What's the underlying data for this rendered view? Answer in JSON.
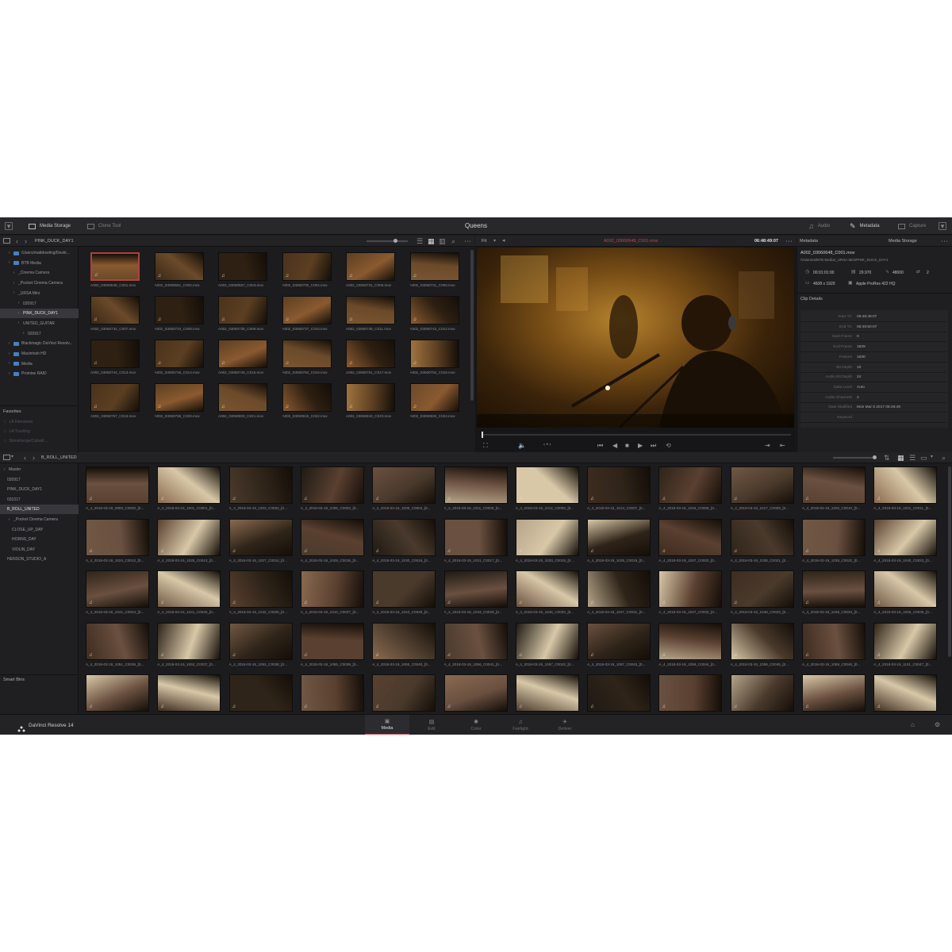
{
  "app": {
    "title": "Queens",
    "brand": "DaVinci Resolve 14"
  },
  "topbar": {
    "media_storage": "Media Storage",
    "clone_tool": "Clone Tool",
    "audio": "Audio",
    "metadata": "Metadata",
    "capture": "Capture"
  },
  "media_storage": {
    "path_label": "PINK_DUCK_DAY1",
    "tree": [
      {
        "label": "/Users/mattdowling/Deskt...",
        "indent": 1,
        "selected": false
      },
      {
        "label": "BTB Media",
        "indent": 1,
        "selected": false
      },
      {
        "label": "_Cinema Camera",
        "indent": 2,
        "selected": false
      },
      {
        "label": "_Pocket Cinema Camera",
        "indent": 2,
        "selected": false
      },
      {
        "label": "_URSA Mini",
        "indent": 2,
        "selected": false
      },
      {
        "label": "020917",
        "indent": 3,
        "selected": false
      },
      {
        "label": "PINK_DUCK_DAY1",
        "indent": 3,
        "selected": true
      },
      {
        "label": "UNITED_GUITAR",
        "indent": 3,
        "selected": false
      },
      {
        "label": "020917",
        "indent": 4,
        "selected": false
      },
      {
        "label": "Blackmagic DaVinci Resolv...",
        "indent": 1,
        "selected": false
      },
      {
        "label": "Macintosh HD",
        "indent": 1,
        "selected": false
      },
      {
        "label": "Media",
        "indent": 1,
        "selected": false
      },
      {
        "label": "Promise RAID",
        "indent": 1,
        "selected": false
      }
    ],
    "favorites_title": "Favorites",
    "favorites": [
      "LA Interviews",
      "LA Tracking",
      "Stonehenge/Cobalt/..."
    ],
    "clips": [
      "A002_03060648_C001.mov",
      "A002_03060651_C002.mov",
      "A002_03060657_C003.mov",
      "A002_03060700_C004.mov",
      "A002_03060731_C005.mov",
      "A002_03060731_C006.mov",
      "A002_03060732_C007.mov",
      "A002_03060734_C008.mov",
      "A002_03060735_C009.mov",
      "A002_03060737_C010.mov",
      "A002_03060738_C011.mov",
      "A002_03060743_C012.mov",
      "A002_03060744_C013.mov",
      "A002_03060746_C014.mov",
      "A002_03060749_C015.mov",
      "A002_03060750_C016.mov",
      "A002_03060751_C017.mov",
      "A002_03060752_C018.mov",
      "A002_03060757_C019.mov",
      "A002_03060758_C020.mov",
      "A002_03060803_C021.mov",
      "A002_03060815_C022.mov",
      "A002_03060819_C023.mov",
      "A002_03060825_C024.mov"
    ]
  },
  "viewer": {
    "zoom": "Fit",
    "clip_name": "A002_03060648_C001.mov",
    "timecode": "06:48:49:07"
  },
  "metadata_panel": {
    "title": "Metadata",
    "context": "Media Storage",
    "file_name": "A002_03060648_C001.mov",
    "file_path": "/Volumes/BTB Media/_URSA Mini/PINK_DUCK_DAY1",
    "duration": "00:01:01:00",
    "fps": "29.970",
    "sample_rate": "48000",
    "channels": "2",
    "resolution": "4608 x 1920",
    "codec": "Apple ProRes 422 HQ",
    "clip_details_title": "Clip Details",
    "details": [
      {
        "k": "Start TC",
        "v": "06:48:49:07"
      },
      {
        "k": "End TC",
        "v": "06:49:50:07"
      },
      {
        "k": "Start Frame",
        "v": "0"
      },
      {
        "k": "End Frame",
        "v": "1829"
      },
      {
        "k": "Frames",
        "v": "1830"
      },
      {
        "k": "Bit Depth",
        "v": "10"
      },
      {
        "k": "Audio Bit Depth",
        "v": "24"
      },
      {
        "k": "Data Level",
        "v": "Auto"
      },
      {
        "k": "Audio Channels",
        "v": "2"
      },
      {
        "k": "Date Modified",
        "v": "Mon Mar 6 2017 06:48:49"
      },
      {
        "k": "Keyword",
        "v": ""
      }
    ]
  },
  "media_pool": {
    "bin_label": "B_ROLL_UNITED",
    "tree": [
      {
        "label": "Master",
        "indent": 0,
        "selected": false
      },
      {
        "label": "020917",
        "indent": 1,
        "selected": false
      },
      {
        "label": "PINK_DUCK_DAY1",
        "indent": 1,
        "selected": false
      },
      {
        "label": "031017",
        "indent": 1,
        "selected": false
      },
      {
        "label": "B_ROLL_UNITED",
        "indent": 1,
        "selected": true
      },
      {
        "label": "_Pocket Cinema Camera",
        "indent": 1,
        "selected": false
      },
      {
        "label": "CLOSE_UP_DAY",
        "indent": 2,
        "selected": false
      },
      {
        "label": "HORNS_DAY",
        "indent": 2,
        "selected": false
      },
      {
        "label": "VIOLIN_DAY",
        "indent": 2,
        "selected": false
      },
      {
        "label": "HENSON_STUDIO_A",
        "indent": 1,
        "selected": false
      }
    ],
    "smart_bins": "Smart Bins",
    "clips": [
      "A_4_2018-03-19_0959_C0000_[0...",
      "A_4_2018-03-19_1001_C0001_[0...",
      "A_4_2018-03-19_1003_C0002_[0...",
      "A_4_2018-03-19_1006_C0003_[0...",
      "A_4_2018-03-19_1009_C0004_[0...",
      "A_4_2018-03-19_1011_C0005_[0...",
      "A_4_2018-03-19_1012_C0006_[0...",
      "A_4_2018-03-19_1014_C0007_[0...",
      "A_4_2018-03-19_1015_C0008_[0...",
      "A_4_2018-03-19_1017_C0009_[0...",
      "A_4_2018-03-19_1020_C0010_[0...",
      "A_4_2018-03-19_1021_C0011_[0...",
      "A_4_2018-03-19_1024_C0012_[0...",
      "A_4_2018-03-19_1025_C0013_[0...",
      "A_4_2018-03-19_1027_C0014_[0...",
      "A_4_2018-03-19_1029_C0015_[0...",
      "A_4_2018-03-19_1030_C0016_[0...",
      "A_4_2018-03-19_1031_C0017_[0...",
      "A_4_2018-03-19_1033_C0018_[0...",
      "A_4_2018-03-19_1035_C0019_[0...",
      "A_4_2018-03-19_1037_C0020_[0...",
      "A_4_2018-03-19_1038_C0021_[0...",
      "A_4_2018-03-19_1039_C0022_[0...",
      "A_4_2018-03-19_1040_C0023_[0...",
      "A_4_2018-03-19_1041_C0024_[0...",
      "A_4_2018-03-19_1041_C0025_[0...",
      "A_4_2018-03-19_1042_C0026_[0...",
      "A_4_2018-03-19_1042_C0027_[0...",
      "A_4_2018-03-19_1043_C0028_[0...",
      "A_4_2018-03-19_1043_C0029_[0...",
      "A_4_2018-03-19_1046_C0030_[0...",
      "A_4_2018-03-19_1047_C0031_[0...",
      "A_4_2018-03-19_1047_C0032_[0...",
      "A_4_2018-03-19_1048_C0033_[0...",
      "A_4_2018-03-19_1048_C0034_[0...",
      "A_4_2018-03-19_1050_C0035_[0...",
      "A_4_2018-03-19_1051_C0036_[0...",
      "A_4_2018-03-19_1052_C0037_[0...",
      "A_4_2018-03-19_1053_C0038_[0...",
      "A_4_2018-03-19_1055_C0039_[0...",
      "A_4_2018-03-19_1055_C0040_[0...",
      "A_4_2018-03-19_1056_C0041_[0...",
      "A_4_2018-03-19_1057_C0042_[0...",
      "A_4_2018-03-19_1057_C0043_[0...",
      "A_4_2018-03-19_1059_C0044_[0...",
      "A_4_2018-03-19_1059_C0045_[0...",
      "A_4_2018-03-19_1059_C0046_[0...",
      "A_4_2018-03-19_1101_C0047_[0...",
      "",
      "",
      "",
      "",
      "",
      "",
      "",
      "",
      "",
      "",
      "",
      ""
    ]
  },
  "pages": [
    {
      "label": "Media",
      "icon": "media-icon",
      "active": true
    },
    {
      "label": "Edit",
      "icon": "edit-icon",
      "active": false
    },
    {
      "label": "Color",
      "icon": "color-icon",
      "active": false
    },
    {
      "label": "Fairlight",
      "icon": "fairlight-icon",
      "active": false
    },
    {
      "label": "Deliver",
      "icon": "deliver-icon",
      "active": false
    }
  ],
  "colors": {
    "accent_red": "#d0505a",
    "panel_bg": "#1c1c1e",
    "header_bg": "#232326"
  }
}
